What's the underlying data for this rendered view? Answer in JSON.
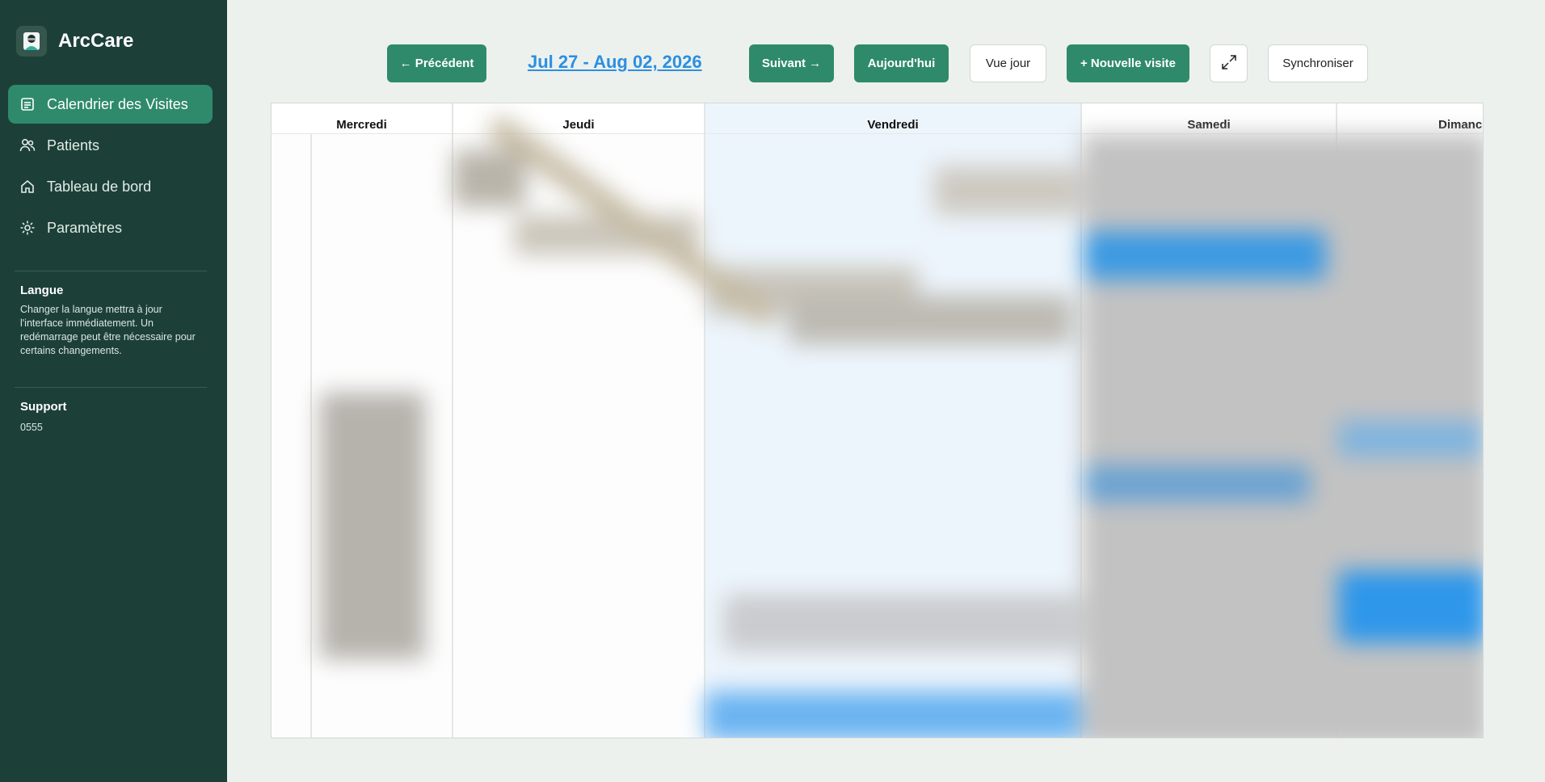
{
  "app": {
    "name": "ArcCare"
  },
  "sidebar": {
    "items": [
      {
        "label": "Calendrier des Visites",
        "icon": "calendar-icon",
        "active": true
      },
      {
        "label": "Patients",
        "icon": "users-icon",
        "active": false
      },
      {
        "label": "Tableau de bord",
        "icon": "home-icon",
        "active": false
      },
      {
        "label": "Paramètres",
        "icon": "gear-icon",
        "active": false
      }
    ],
    "language": {
      "title": "Langue",
      "text": "Changer la langue mettra à jour l'interface immédiatement. Un redémarrage peut être nécessaire pour certains changements."
    },
    "support": {
      "title": "Support",
      "phone": "0555"
    }
  },
  "toolbar": {
    "prev_label": "← Précédent",
    "date_range": "Jul 27 - Aug 02, 2026",
    "next_label": "Suivant →",
    "today_label": "Aujourd'hui",
    "day_view_label": "Vue jour",
    "new_visit_label": "+ Nouvelle visite",
    "expand_icon": "expand-icon",
    "sync_label": "Synchroniser"
  },
  "calendar": {
    "days": [
      "Mercredi",
      "Jeudi",
      "Vendredi",
      "Samedi",
      "Dimanche"
    ],
    "highlighted_day": "Vendredi"
  },
  "colors": {
    "sidebar_bg": "#1c4038",
    "accent_green": "#2f8a6c",
    "link_blue": "#2c8fe0",
    "event_blue": "#2f9be8",
    "page_bg": "#ecf1ee"
  }
}
